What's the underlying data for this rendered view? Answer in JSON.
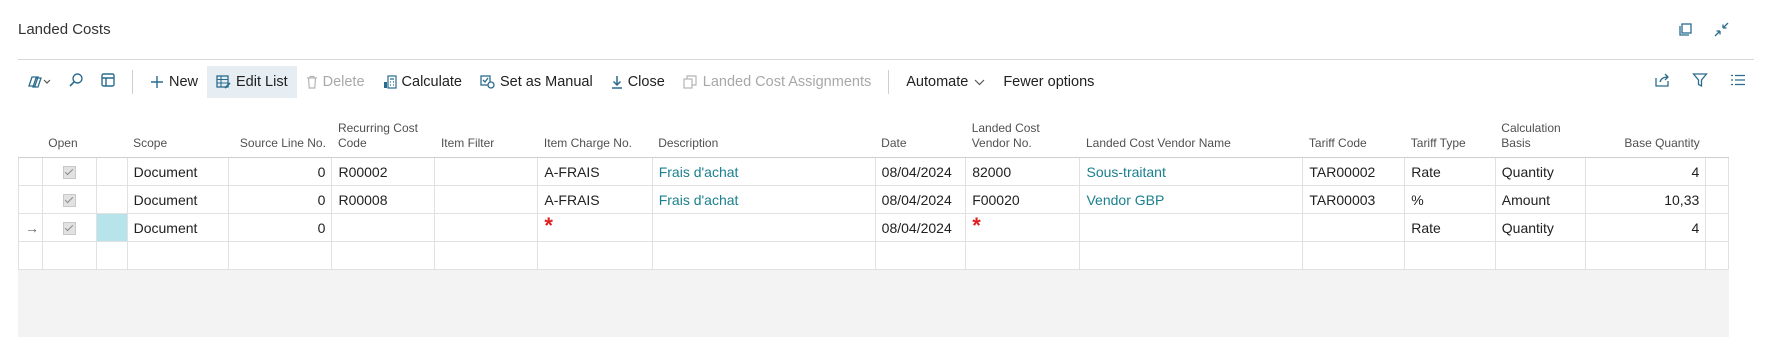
{
  "page": {
    "title": "Landed Costs"
  },
  "toolbar": {
    "new_label": "New",
    "edit_list_label": "Edit List",
    "delete_label": "Delete",
    "calculate_label": "Calculate",
    "set_manual_label": "Set as Manual",
    "close_label": "Close",
    "assignments_label": "Landed Cost Assignments",
    "automate_label": "Automate",
    "fewer_options_label": "Fewer options"
  },
  "columns": {
    "open": "Open",
    "scope": "Scope",
    "source_line_no": "Source Line No.",
    "recurring_cost_code": "Recurring Cost Code",
    "item_filter": "Item Filter",
    "item_charge_no": "Item Charge No.",
    "description": "Description",
    "date": "Date",
    "landed_cost_vendor_no": "Landed Cost Vendor No.",
    "landed_cost_vendor_name": "Landed Cost Vendor Name",
    "tariff_code": "Tariff Code",
    "tariff_type": "Tariff Type",
    "calculation_basis": "Calculation Basis",
    "base_quantity": "Base Quantity"
  },
  "rows": [
    {
      "scope": "Document",
      "source_line_no": "0",
      "recurring_cost_code": "R00002",
      "item_filter": "",
      "item_charge_no": "A-FRAIS",
      "description": "Frais d'achat",
      "date": "08/04/2024",
      "vendor_no": "82000",
      "vendor_name": "Sous-traitant",
      "tariff_code": "TAR00002",
      "tariff_type": "Rate",
      "calculation_basis": "Quantity",
      "base_quantity": "4"
    },
    {
      "scope": "Document",
      "source_line_no": "0",
      "recurring_cost_code": "R00008",
      "item_filter": "",
      "item_charge_no": "A-FRAIS",
      "description": "Frais d'achat",
      "date": "08/04/2024",
      "vendor_no": "F00020",
      "vendor_name": "Vendor GBP",
      "tariff_code": "TAR00003",
      "tariff_type": "%",
      "calculation_basis": "Amount",
      "base_quantity": "10,33"
    },
    {
      "scope": "Document",
      "source_line_no": "0",
      "recurring_cost_code": "",
      "item_filter": "",
      "item_charge_no": "",
      "description": "",
      "date": "08/04/2024",
      "vendor_no": "",
      "vendor_name": "",
      "tariff_code": "",
      "tariff_type": "Rate",
      "calculation_basis": "Quantity",
      "base_quantity": "4"
    }
  ],
  "glyphs": {
    "required": "*",
    "current_row": "→"
  },
  "colors": {
    "link": "#1a7f8e",
    "accent": "#2a6c8e",
    "required": "#e02020",
    "selected_cell": "#b7e3ea"
  }
}
